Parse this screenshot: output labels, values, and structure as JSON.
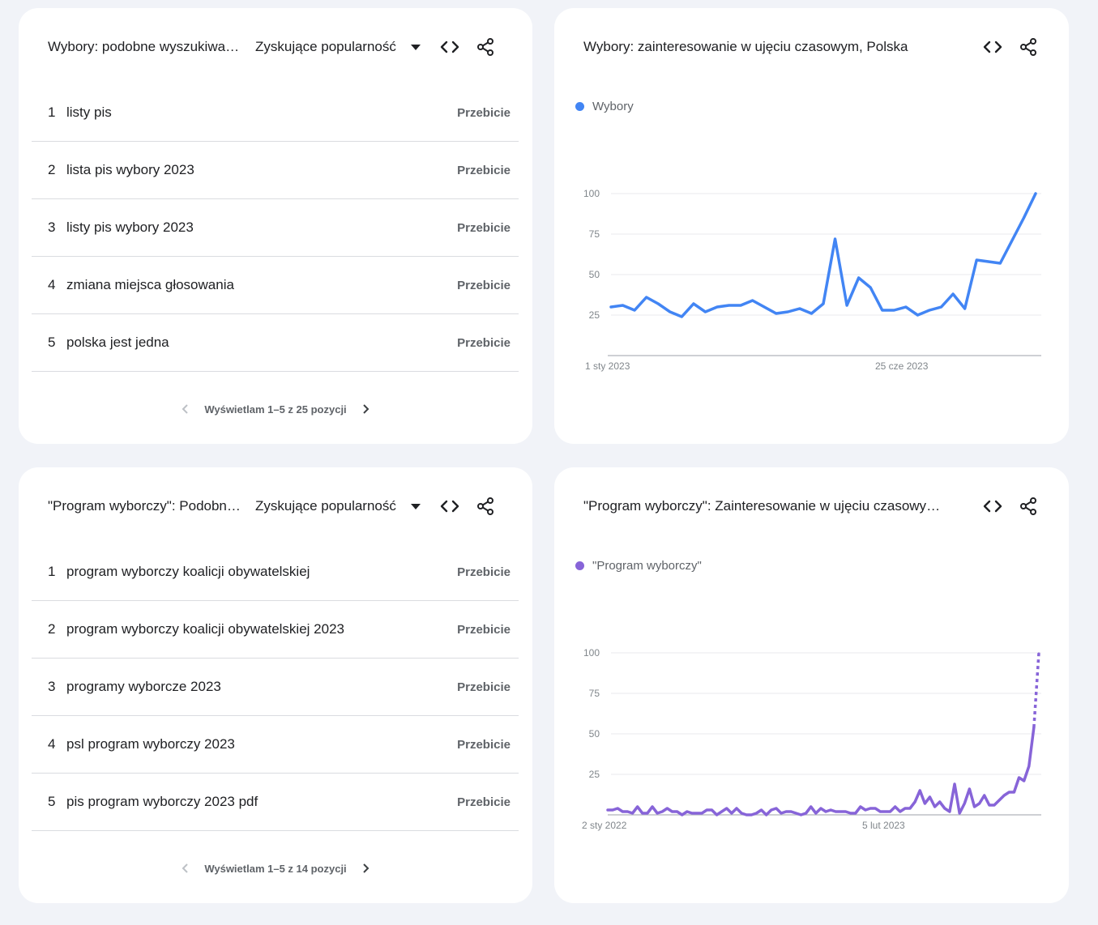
{
  "colors": {
    "series_blue": "#4285f4",
    "series_purple": "#8764d8",
    "grid": "#e8eaed",
    "axis": "#bdc1c6"
  },
  "icons": {
    "embed": "code-brackets-icon",
    "share": "share-icon",
    "sort": "caret-down-icon",
    "prev": "chevron-left-icon",
    "next": "chevron-right-icon"
  },
  "cards": {
    "top_left": {
      "title": "Wybory: podobne wyszukiwania",
      "sort_label": "Zyskujące popularność",
      "rows": [
        {
          "rank": "1",
          "query": "listy pis",
          "value": "Przebicie"
        },
        {
          "rank": "2",
          "query": "lista pis wybory 2023",
          "value": "Przebicie"
        },
        {
          "rank": "3",
          "query": "listy pis wybory 2023",
          "value": "Przebicie"
        },
        {
          "rank": "4",
          "query": "zmiana miejsca głosowania",
          "value": "Przebicie"
        },
        {
          "rank": "5",
          "query": "polska jest jedna",
          "value": "Przebicie"
        }
      ],
      "pager_text": "Wyświetlam 1–5 z 25 pozycji"
    },
    "bottom_left": {
      "title": "\"Program wyborczy\": Podobne wyszukiwania",
      "sort_label": "Zyskujące popularność",
      "rows": [
        {
          "rank": "1",
          "query": "program wyborczy koalicji obywatelskiej",
          "value": "Przebicie"
        },
        {
          "rank": "2",
          "query": "program wyborczy koalicji obywatelskiej 2023",
          "value": "Przebicie"
        },
        {
          "rank": "3",
          "query": "programy wyborcze 2023",
          "value": "Przebicie"
        },
        {
          "rank": "4",
          "query": "psl program wyborczy 2023",
          "value": "Przebicie"
        },
        {
          "rank": "5",
          "query": "pis program wyborczy 2023 pdf",
          "value": "Przebicie"
        }
      ],
      "pager_text": "Wyświetlam 1–5 z 14 pozycji"
    },
    "top_right": {
      "title": "Wybory: zainteresowanie w ujęciu czasowym, Polska"
    },
    "bottom_right": {
      "title": "\"Program wyborczy\": Zainteresowanie w ujęciu czasowym, Polska"
    }
  },
  "chart_data": [
    {
      "type": "line",
      "title": "Wybory: zainteresowanie w ujęciu czasowym, Polska",
      "x_tick_labels": [
        "1 sty 2023",
        "25 cze 2023"
      ],
      "y_ticks": [
        25,
        50,
        75,
        100
      ],
      "ylim": [
        0,
        100
      ],
      "grid": true,
      "legend_position": "top-left",
      "series": [
        {
          "name": "Wybory",
          "color": "#4285f4",
          "values": [
            30,
            31,
            28,
            36,
            32,
            27,
            24,
            32,
            27,
            30,
            31,
            31,
            34,
            30,
            26,
            27,
            29,
            26,
            32,
            72,
            31,
            48,
            42,
            28,
            28,
            30,
            25,
            28,
            30,
            38,
            29,
            59,
            58,
            57,
            71,
            85,
            100
          ],
          "partial_last_points": 0
        }
      ]
    },
    {
      "type": "line",
      "title": "\"Program wyborczy\": Zainteresowanie w ujęciu czasowym, Polska",
      "x_tick_labels": [
        "2 sty 2022",
        "5 lut 2023"
      ],
      "y_ticks": [
        25,
        50,
        75,
        100
      ],
      "ylim": [
        0,
        100
      ],
      "grid": true,
      "legend_position": "top-left",
      "series": [
        {
          "name": "\"Program wyborczy\"",
          "color": "#8764d8",
          "values": [
            3,
            3,
            4,
            2,
            2,
            1,
            5,
            1,
            1,
            5,
            1,
            2,
            4,
            2,
            2,
            0,
            2,
            1,
            1,
            1,
            3,
            3,
            0,
            2,
            4,
            1,
            4,
            1,
            0,
            0,
            1,
            3,
            0,
            3,
            4,
            1,
            2,
            2,
            1,
            0,
            1,
            5,
            1,
            4,
            2,
            3,
            2,
            2,
            2,
            1,
            1,
            5,
            3,
            4,
            4,
            2,
            2,
            2,
            5,
            2,
            4,
            4,
            8,
            15,
            7,
            11,
            5,
            8,
            4,
            2,
            19,
            1,
            7,
            16,
            5,
            7,
            12,
            6,
            6,
            9,
            12,
            14,
            14,
            23,
            21,
            30,
            54,
            100
          ],
          "partial_last_points": 1
        }
      ]
    }
  ]
}
